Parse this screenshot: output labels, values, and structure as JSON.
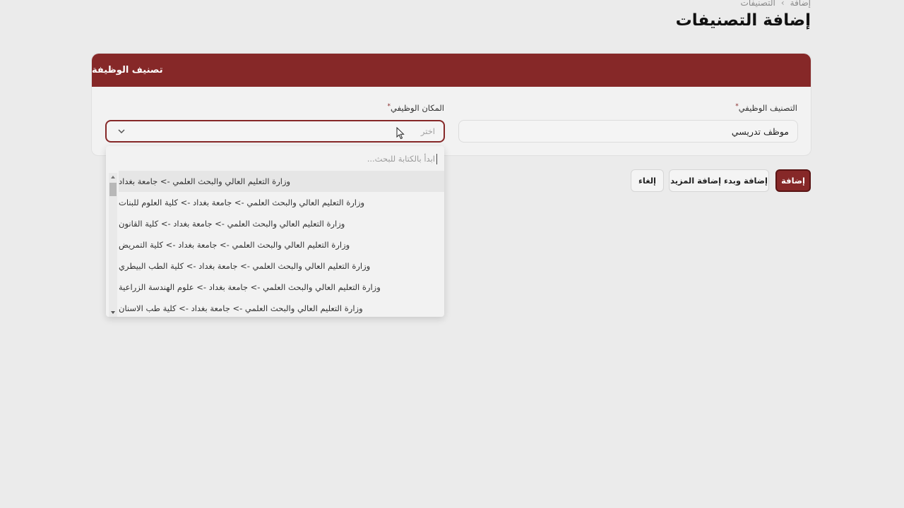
{
  "breadcrumb": {
    "items": [
      "التصنيفات",
      "إضافة"
    ],
    "separator": "›"
  },
  "page": {
    "title": "إضافة التصنيفات"
  },
  "card": {
    "header": "تصنيف الوظيفة",
    "job_classification": {
      "label": "التصنيف الوظيفي",
      "required_mark": "*",
      "value": "موظف تدريسي"
    },
    "job_place": {
      "label": "المكان الوظيفي",
      "required_mark": "*",
      "placeholder": "اختر"
    }
  },
  "dropdown": {
    "search_placeholder": "ابدأ بالكتابة للبحث...",
    "options": [
      "وزارة التعليم العالي والبحث العلمي -> جامعة بغداد",
      "وزارة التعليم العالي والبحث العلمي -> جامعة بغداد -> كلية العلوم للبنات",
      "وزارة التعليم العالي والبحث العلمي -> جامعة بغداد -> كلية القانون",
      "وزارة التعليم العالي والبحث العلمي -> جامعة بغداد -> كلية التمريض",
      "وزارة التعليم العالي والبحث العلمي -> جامعة بغداد -> كلية الطب البيطري",
      "وزارة التعليم العالي والبحث العلمي -> جامعة بغداد -> علوم الهندسة الزراعية",
      "وزارة التعليم العالي والبحث العلمي -> جامعة بغداد -> كلية طب الاسنان"
    ]
  },
  "actions": {
    "add": "إضافة",
    "add_and_more": "إضافة وبدء إضافة المزيد",
    "cancel": "إلغاء"
  },
  "colors": {
    "brand": "#862828",
    "background": "#ebebeb"
  }
}
